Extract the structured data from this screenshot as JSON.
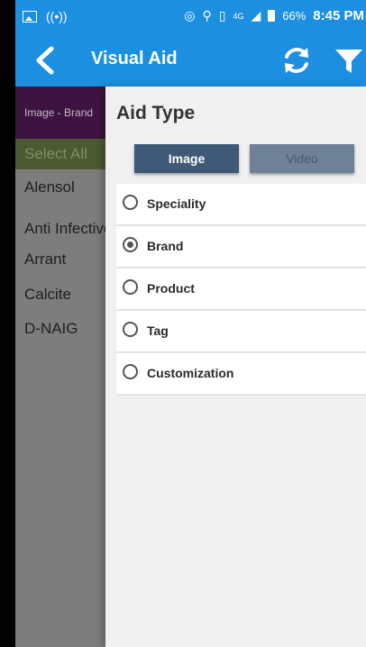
{
  "status": {
    "battery": "66%",
    "time": "8:45 PM",
    "network": "4G"
  },
  "appbar": {
    "title": "Visual Aid"
  },
  "list": {
    "header": "Image - Brand",
    "select_all": "Select All",
    "items": [
      "Alensol",
      "Anti Infective",
      "Arrant",
      "Calcite",
      "D-NAIG"
    ]
  },
  "drawer": {
    "title": "Aid Type",
    "tabs": [
      {
        "label": "Image",
        "selected": true
      },
      {
        "label": "Video",
        "selected": false
      }
    ],
    "options": [
      {
        "label": "Speciality",
        "selected": false
      },
      {
        "label": "Brand",
        "selected": true
      },
      {
        "label": "Product",
        "selected": false
      },
      {
        "label": "Tag",
        "selected": false
      },
      {
        "label": "Customization",
        "selected": false
      }
    ]
  },
  "colors": {
    "accent": "#1d8fe1",
    "tab_active": "#3e5a77",
    "tab_inactive": "#6e8197"
  }
}
